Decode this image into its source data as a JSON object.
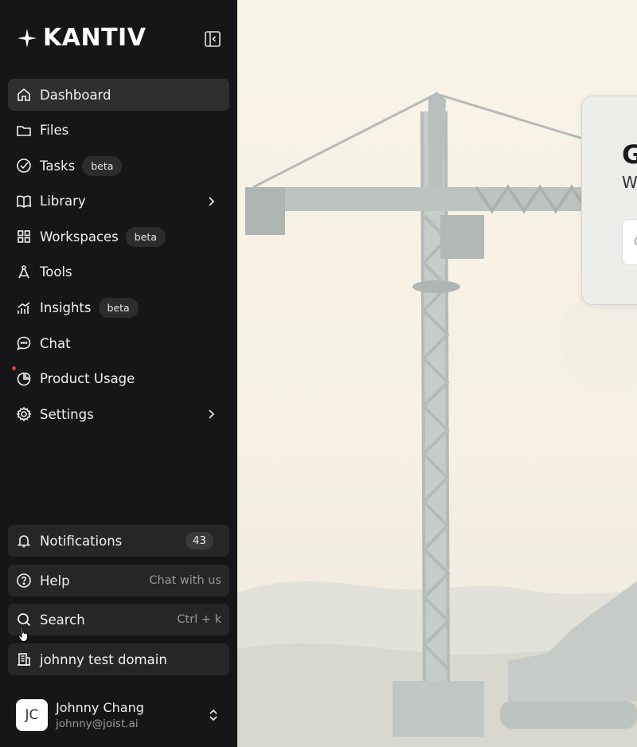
{
  "brand": {
    "name": "KANTIV"
  },
  "nav": [
    {
      "id": "dashboard",
      "label": "Dashboard",
      "icon": "home-icon",
      "active": true
    },
    {
      "id": "files",
      "label": "Files",
      "icon": "folder-icon"
    },
    {
      "id": "tasks",
      "label": "Tasks",
      "icon": "check-circle-icon",
      "badge": "beta"
    },
    {
      "id": "library",
      "label": "Library",
      "icon": "book-icon",
      "expandable": true
    },
    {
      "id": "workspaces",
      "label": "Workspaces",
      "icon": "grid-icon",
      "badge": "beta"
    },
    {
      "id": "tools",
      "label": "Tools",
      "icon": "compass-icon"
    },
    {
      "id": "insights",
      "label": "Insights",
      "icon": "chart-icon",
      "badge": "beta"
    },
    {
      "id": "chat",
      "label": "Chat",
      "icon": "chat-bubble-icon"
    },
    {
      "id": "product-usage",
      "label": "Product Usage",
      "icon": "pie-chart-icon",
      "dot": true
    },
    {
      "id": "settings",
      "label": "Settings",
      "icon": "gear-icon",
      "expandable": true
    }
  ],
  "bottom": {
    "notifications": {
      "label": "Notifications",
      "count": "43"
    },
    "help": {
      "label": "Help",
      "hint": "Chat with us"
    },
    "search": {
      "label": "Search",
      "hint": "Ctrl + k"
    },
    "domain": {
      "label": "johnny test domain"
    }
  },
  "user": {
    "initials": "JC",
    "name": "Johnny Chang",
    "email": "johnny@joist.ai"
  },
  "main": {
    "card": {
      "title": "G",
      "subtitle": "W",
      "input_placeholder": "C"
    }
  },
  "colors": {
    "sidebar_bg": "#161618",
    "active_bg": "#2f2f31",
    "background": "#f7f2e4",
    "notification_dot": "#e23b3b"
  }
}
